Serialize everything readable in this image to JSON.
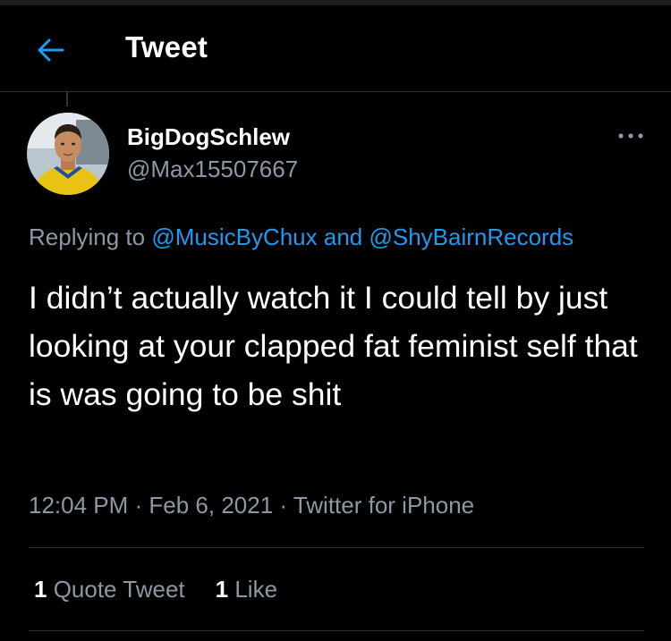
{
  "header": {
    "title": "Tweet",
    "back_icon": "arrow-left-icon",
    "accent_color": "#1d9bf0"
  },
  "tweet": {
    "author": {
      "display_name": "BigDogSchlew",
      "handle": "@Max15507667",
      "avatar_icon": "profile-photo"
    },
    "more_icon": "more-horizontal-icon",
    "replying_to": {
      "prefix": "Replying to ",
      "mention_1": "@MusicByChux",
      "joiner": " and ",
      "mention_2": "@ShyBairnRecords"
    },
    "text": "I didn’t actually watch it I could tell by just looking at your clapped fat feminist self that is was going to be shit",
    "meta": {
      "time": "12:04 PM",
      "separator": " · ",
      "date": "Feb 6, 2021",
      "source": "Twitter for iPhone"
    },
    "stats": {
      "quote_count": "1",
      "quote_label": " Quote Tweet",
      "like_count": "1",
      "like_label": " Like"
    }
  },
  "colors": {
    "background": "#000000",
    "text_primary": "#ffffff",
    "text_secondary": "#8b98a5",
    "link": "#1d9bf0",
    "divider": "#2f3336"
  }
}
